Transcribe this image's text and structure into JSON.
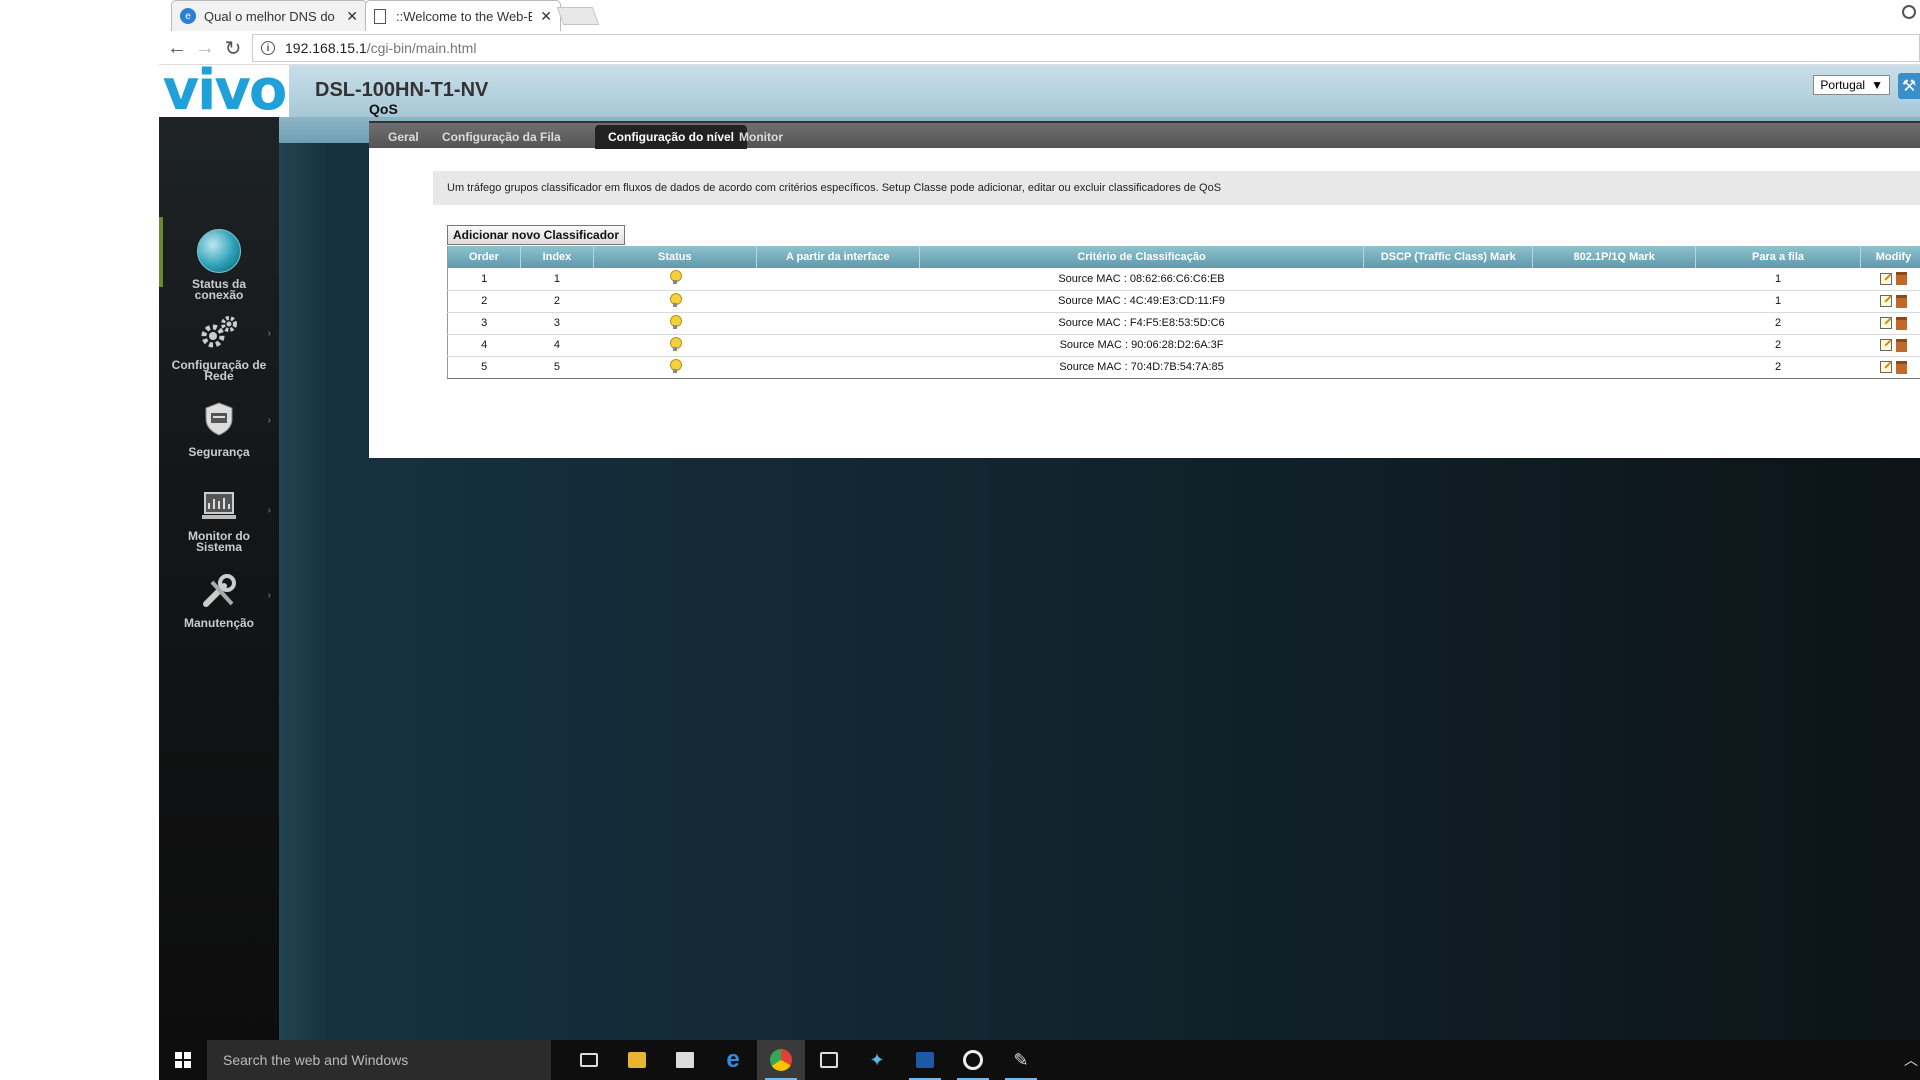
{
  "browser": {
    "tabs": [
      {
        "title": "Qual o melhor DNS do B",
        "favicon": "site-favicon",
        "active": false
      },
      {
        "title": "::Welcome to the Web-B",
        "favicon": "document-icon",
        "active": true
      }
    ],
    "close_glyph": "✕",
    "url_host": "192.168.15.1",
    "url_path": "/cgi-bin/main.html"
  },
  "router": {
    "logo": "vivo",
    "model": "DSL-100HN-T1-NV",
    "language": "Portugal",
    "section_title": "QoS",
    "sidebar": [
      {
        "label1": "Status da",
        "label2": "conexão",
        "icon": "globe-icon"
      },
      {
        "label1": "Configuração de",
        "label2": "Rede",
        "icon": "gears-icon"
      },
      {
        "label1": "Segurança",
        "label2": "",
        "icon": "shield-icon"
      },
      {
        "label1": "Monitor do",
        "label2": "Sistema",
        "icon": "monitor-icon"
      },
      {
        "label1": "Manutenção",
        "label2": "",
        "icon": "wrench-icon"
      }
    ],
    "tabs": [
      "Geral",
      "Configuração da Fila",
      "Configuração do nível",
      "Monitor"
    ],
    "active_tab": "Configuração do nível",
    "description": "Um tráfego grupos classificador em fluxos de dados de acordo com critérios específicos. Setup Classe pode adicionar, editar ou excluir classificadores de QoS",
    "add_button": "Adicionar novo Classificador",
    "table": {
      "headers": [
        "Order",
        "Index",
        "Status",
        "A partir da interface",
        "Critério de Classificação",
        "DSCP (Traffic Class) Mark",
        "802.1P/1Q Mark",
        "Para a fila",
        "Modify"
      ],
      "rows": [
        {
          "order": "1",
          "index": "1",
          "status": "enabled",
          "interface": "",
          "criteria": "Source MAC : 08:62:66:C6:C6:EB",
          "dscp": "",
          "p8021": "",
          "queue": "1"
        },
        {
          "order": "2",
          "index": "2",
          "status": "enabled",
          "interface": "",
          "criteria": "Source MAC : 4C:49:E3:CD:11:F9",
          "dscp": "",
          "p8021": "",
          "queue": "1"
        },
        {
          "order": "3",
          "index": "3",
          "status": "enabled",
          "interface": "",
          "criteria": "Source MAC : F4:F5:E8:53:5D:C6",
          "dscp": "",
          "p8021": "",
          "queue": "2"
        },
        {
          "order": "4",
          "index": "4",
          "status": "enabled",
          "interface": "",
          "criteria": "Source MAC : 90:06:28:D2:6A:3F",
          "dscp": "",
          "p8021": "",
          "queue": "2"
        },
        {
          "order": "5",
          "index": "5",
          "status": "enabled",
          "interface": "",
          "criteria": "Source MAC : 70:4D:7B:54:7A:85",
          "dscp": "",
          "p8021": "",
          "queue": "2"
        }
      ]
    }
  },
  "taskbar": {
    "search_placeholder": "Search the web and Windows",
    "apps": [
      "task-view-icon",
      "file-explorer-icon",
      "store-icon",
      "edge-icon",
      "chrome-icon",
      "app-icon",
      "app-icon",
      "app-icon",
      "overwatch-icon",
      "app-icon"
    ]
  },
  "colors": {
    "vivo_blue": "#1fa0d8",
    "header_teal": "#5e9aab",
    "tab_active": "#222222"
  }
}
